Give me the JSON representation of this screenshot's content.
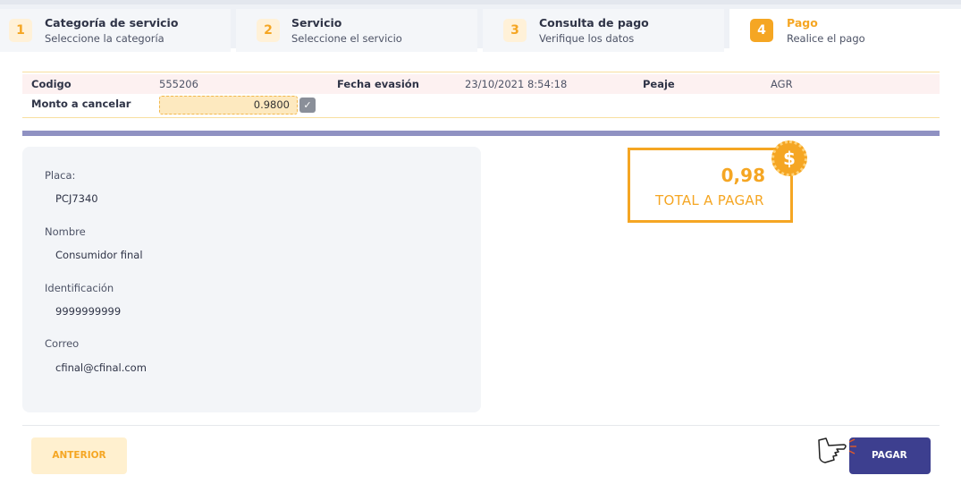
{
  "steps": [
    {
      "number": "1",
      "title": "Categoría de servicio",
      "subtitle": "Seleccione la categoría"
    },
    {
      "number": "2",
      "title": "Servicio",
      "subtitle": "Seleccione el servicio"
    },
    {
      "number": "3",
      "title": "Consulta de pago",
      "subtitle": "Verifique los datos"
    },
    {
      "number": "4",
      "title": "Pago",
      "subtitle": "Realice el pago"
    }
  ],
  "info": {
    "codigo_label": "Codigo",
    "codigo_value": "555206",
    "fecha_label": "Fecha evasión",
    "fecha_value": "23/10/2021 8:54:18",
    "peaje_label": "Peaje",
    "peaje_value": "AGR",
    "monto_label": "Monto a cancelar",
    "monto_value": "0.9800"
  },
  "details": {
    "placa_label": "Placa:",
    "placa_value": "PCJ7340",
    "nombre_label": "Nombre",
    "nombre_value": "Consumidor final",
    "identificacion_label": "Identificación",
    "identificacion_value": "9999999999",
    "correo_label": "Correo",
    "correo_value": "cfinal@cfinal.com"
  },
  "total": {
    "amount": "0,98",
    "label": "TOTAL A PAGAR",
    "badge": "$"
  },
  "buttons": {
    "prev_label": "ANTERIOR",
    "pay_label": "PAGAR"
  },
  "colors": {
    "accent": "#f5a623",
    "primary_button": "#3d3f8f",
    "divider": "#8f91c2"
  },
  "icons": {
    "check": "check-icon",
    "badge": "dollar-icon",
    "pointer": "hand-pointer-icon"
  }
}
